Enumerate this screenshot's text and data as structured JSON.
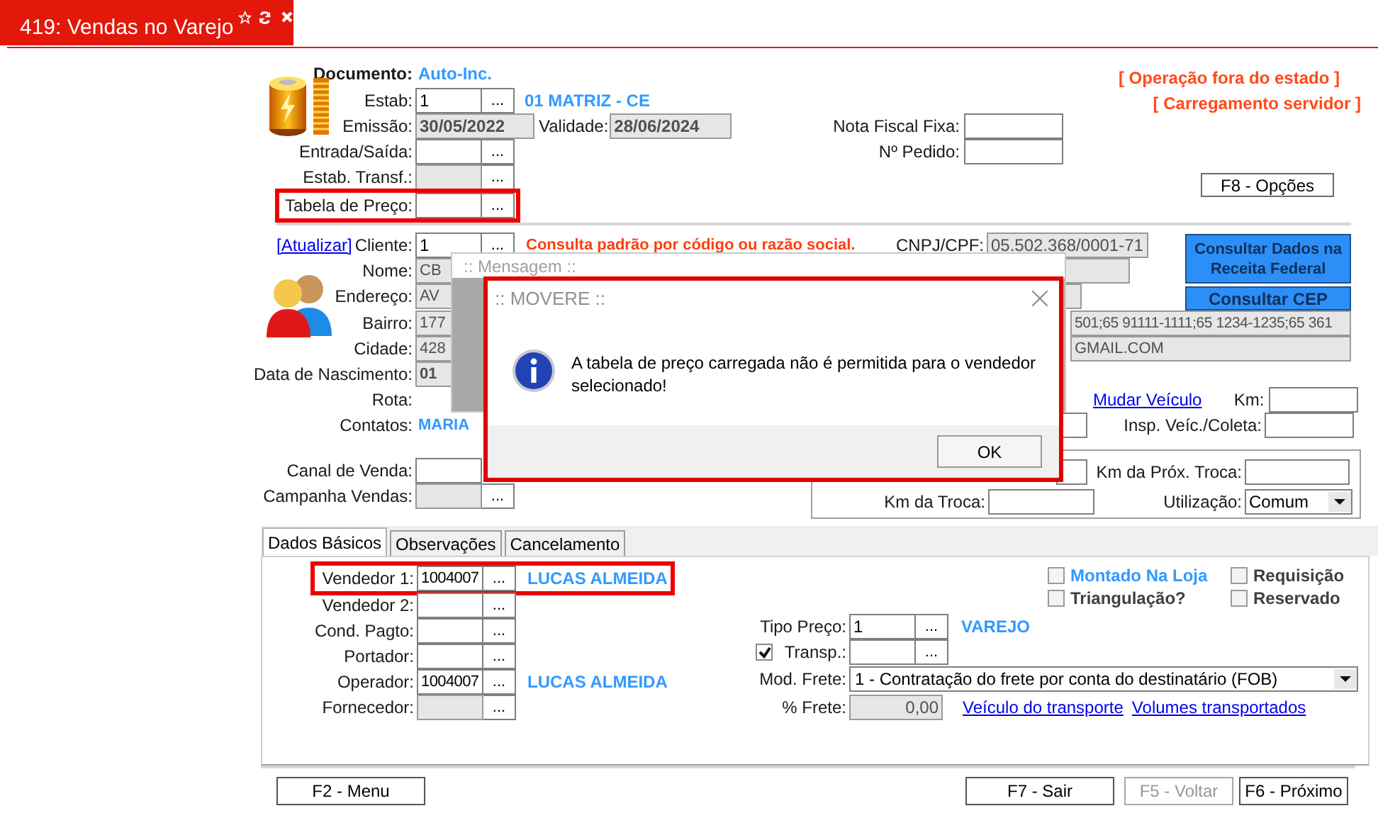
{
  "tab": {
    "title": "419: Vendas no Varejo"
  },
  "document": {
    "label": "Documento:",
    "value": "Auto-Inc."
  },
  "notices": [
    "[ Operação fora do estado ]",
    "[ Carregamento servidor ]"
  ],
  "estab": {
    "label": "Estab:",
    "value": "1",
    "lookup": "...",
    "description": "01 MATRIZ - CE"
  },
  "emissao": {
    "label": "Emissão:",
    "value": "30/05/2022",
    "disabled": true
  },
  "validade": {
    "label": "Validade:",
    "value": "28/06/2024",
    "disabled": true
  },
  "entrada_saida": {
    "label": "Entrada/Saída:",
    "lookup": "..."
  },
  "estab_transf": {
    "label": "Estab. Transf.:",
    "lookup": "...",
    "disabled": true
  },
  "tabela_preco": {
    "label": "Tabela de Preço:",
    "lookup": "...",
    "highlighted": true
  },
  "nota_fiscal_fixa": {
    "label": "Nota Fiscal Fixa:"
  },
  "numero_pedido": {
    "label": "Nº Pedido:"
  },
  "options_button": "F8 - Opções",
  "client": {
    "refresh_link": "[Atualizar]",
    "label": "Cliente:",
    "value": "1",
    "lookup": "...",
    "hint": "Consulta padrão por código ou razão social.",
    "cnpj_label": "CNPJ/CPF:",
    "cnpj": "05.502.368/0001-71"
  },
  "client_rows": [
    {
      "label": "Nome:",
      "value": "CB",
      "kind": "text"
    },
    {
      "label": "Endereço:",
      "value": "AV",
      "kind": "text"
    },
    {
      "label": "Bairro:",
      "value": "177",
      "kind": "text"
    },
    {
      "label": "Cidade:",
      "value": "428",
      "kind": "text"
    },
    {
      "label": "Data de Nascimento:",
      "value": "01",
      "kind": "date"
    }
  ],
  "receita_button": "Consultar Dados na Receita Federal",
  "cep_button": "Consultar CEP",
  "phones": "501;65 91111-1111;65 1234-1235;65 361",
  "email": "GMAIL.COM",
  "rota": {
    "label": "Rota:"
  },
  "vehicle_link": "Mudar Veículo",
  "km": {
    "label": "Km:"
  },
  "contatos": {
    "label": "Contatos:",
    "value": "MARIA"
  },
  "inspecao": {
    "label": "Insp. Veíc./Coleta:"
  },
  "canal": {
    "label": "Canal de Venda:"
  },
  "campanha": {
    "label": "Campanha Vendas:",
    "lookup": "...",
    "disabled": true
  },
  "km_proxima": {
    "label": "Km da Próx. Troca:"
  },
  "km_troca": {
    "label": "Km da Troca:"
  },
  "utilizacao": {
    "label": "Utilização:",
    "value": "Comum"
  },
  "tabs": [
    {
      "label": "Dados Básicos",
      "selected": true
    },
    {
      "label": "Observações",
      "selected": false
    },
    {
      "label": "Cancelamento",
      "selected": false
    }
  ],
  "people": [
    {
      "label": "Vendedor 1:",
      "value": "1004007",
      "lookup": "...",
      "name": "LUCAS ALMEIDA",
      "highlighted": true,
      "disabled": false
    },
    {
      "label": "Vendedor 2:",
      "lookup": "...",
      "highlighted": false,
      "disabled": false
    },
    {
      "label": "Cond. Pagto:",
      "lookup": "...",
      "highlighted": false,
      "disabled": false
    },
    {
      "label": "Portador:",
      "lookup": "...",
      "highlighted": false,
      "disabled": false
    },
    {
      "label": "Operador:",
      "value": "1004007",
      "lookup": "...",
      "name": "LUCAS ALMEIDA",
      "highlighted": false,
      "disabled": false
    },
    {
      "label": "Fornecedor:",
      "lookup": "...",
      "highlighted": false,
      "disabled": true
    }
  ],
  "flags": [
    {
      "label": "Montado Na Loja",
      "checked": false,
      "color": "#3399ff"
    },
    {
      "label": "Requisição",
      "checked": false,
      "color": "#404040"
    },
    {
      "label": "Triangulação?",
      "checked": false,
      "color": "#404040"
    },
    {
      "label": "Reservado",
      "checked": false,
      "color": "#404040"
    }
  ],
  "tipo_preco": {
    "label": "Tipo Preço:",
    "value": "1",
    "lookup": "...",
    "description": "VAREJO"
  },
  "transp": {
    "label": "Transp.:",
    "checked": true,
    "lookup": "..."
  },
  "mod_frete": {
    "label": "Mod. Frete:",
    "value": "1 - Contratação do frete por conta do destinatário (FOB)"
  },
  "frete": {
    "label": "% Frete:",
    "value": "0,00",
    "disabled": true
  },
  "links": [
    "Veículo do transporte",
    "Volumes transportados"
  ],
  "footer_buttons": [
    {
      "label": "F2 - Menu",
      "disabled": false
    },
    {
      "label": "F7 - Sair",
      "disabled": false
    },
    {
      "label": "F5 - Voltar",
      "disabled": true
    },
    {
      "label": "F6 - Próximo",
      "disabled": false
    }
  ],
  "background_dialog": {
    "title": ":: Mensagem ::"
  },
  "dialog": {
    "title": ":: MOVERE ::",
    "message": "A tabela de preço carregada não é permitida para o vendedor selecionado!",
    "button": "OK"
  }
}
